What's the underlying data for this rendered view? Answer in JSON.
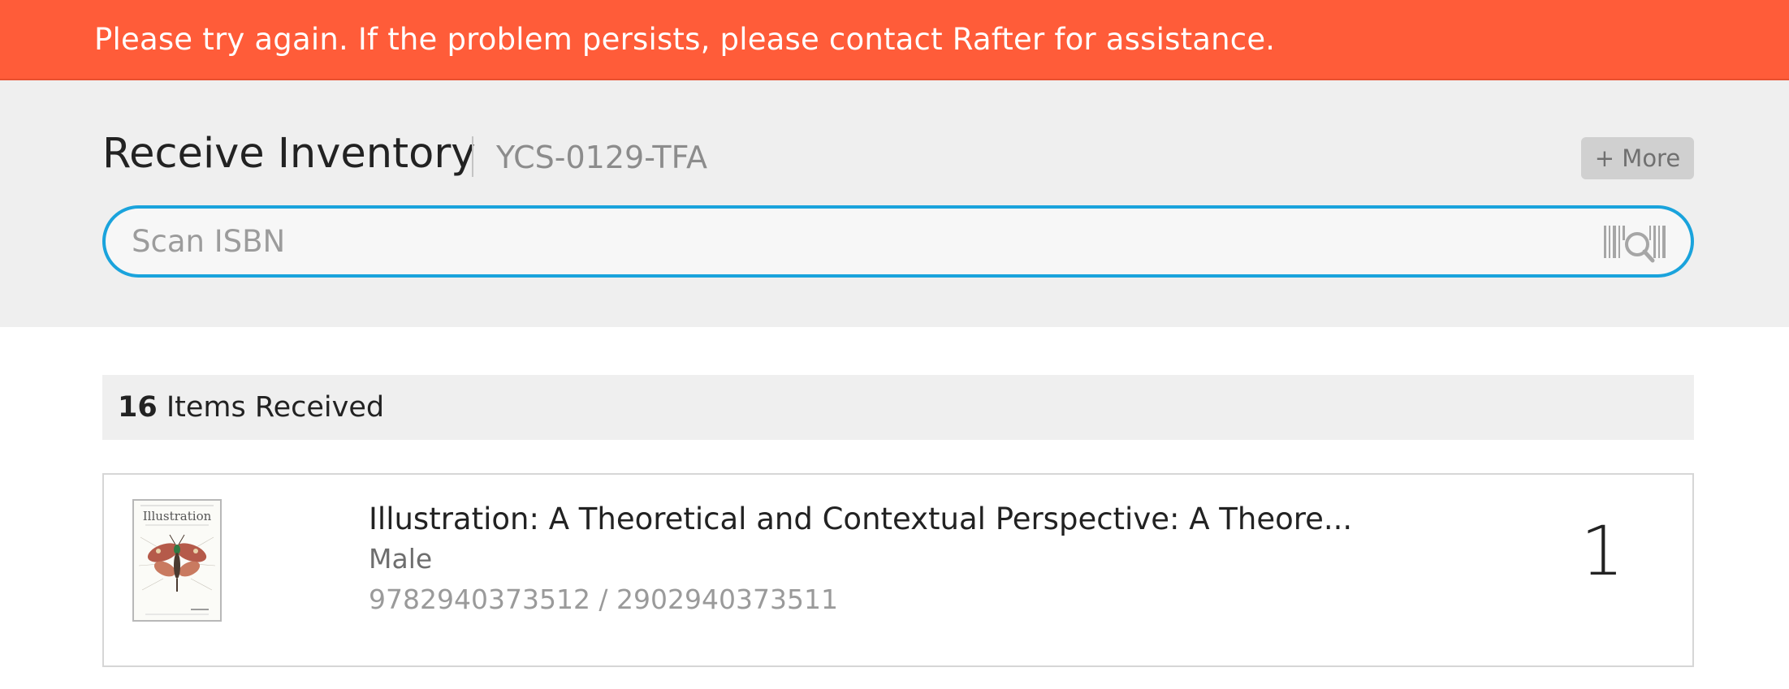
{
  "alert": {
    "message": "Please try again. If the problem persists, please contact Rafter for assistance.",
    "color": "#ff5c39"
  },
  "header": {
    "title": "Receive Inventory",
    "po_number": "YCS-0129-TFA",
    "more_label": "+ More"
  },
  "scan": {
    "placeholder": "Scan ISBN",
    "value": "",
    "icon": "barcode-scan-icon",
    "accent_color": "#1aa3dc"
  },
  "received": {
    "count": "16",
    "label": " Items Received"
  },
  "items": [
    {
      "cover_title": "Illustration",
      "title": "Illustration: A Theoretical and Contextual Perspective: A Theore...",
      "subtitle": "Male",
      "isbns": "9782940373512 / 2902940373511",
      "quantity": "1"
    }
  ]
}
